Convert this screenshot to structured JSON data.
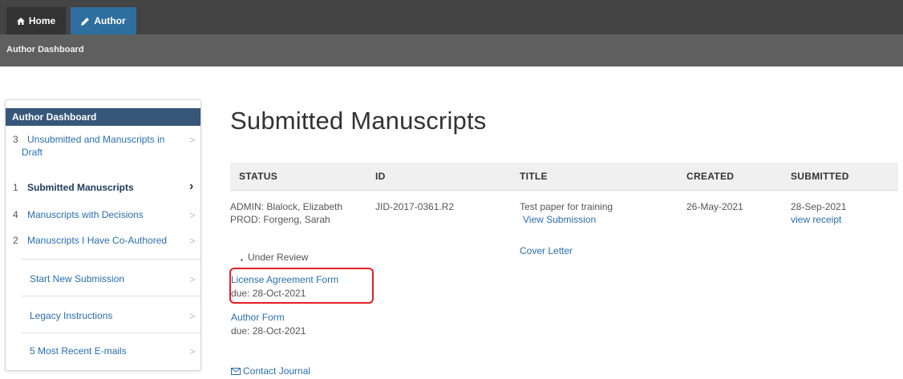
{
  "nav": {
    "home_label": "Home",
    "home_icon": "home-icon",
    "author_label": "Author",
    "author_icon": "pencil-icon",
    "breadcrumb": "Author Dashboard"
  },
  "sidebar": {
    "title": "Author Dashboard",
    "items": [
      {
        "count": "3",
        "label": "Unsubmitted and Manuscripts in",
        "label_line2": "Draft"
      },
      {
        "count": "1",
        "label": "Submitted Manuscripts"
      },
      {
        "count": "4",
        "label": "Manuscripts with Decisions"
      },
      {
        "count": "2",
        "label": "Manuscripts I Have Co-Authored"
      },
      {
        "label": "Start New Submission"
      },
      {
        "label": "Legacy Instructions"
      },
      {
        "label": "5 Most Recent E-mails"
      }
    ],
    "chevron": ">",
    "active_chevron": "›"
  },
  "main": {
    "title": "Submitted Manuscripts",
    "columns": [
      "STATUS",
      "ID",
      "TITLE",
      "CREATED",
      "SUBMITTED"
    ],
    "row": {
      "admin": "ADMIN: Blalock, Elizabeth",
      "prod": "PROD: Forgeng, Sarah",
      "status": "Under Review",
      "license_form": "License Agreement Form",
      "license_due": "due: 28-Oct-2021",
      "author_form": "Author Form",
      "author_due": "due: 28-Oct-2021",
      "contact": "Contact Journal",
      "id": "JID-2017-0361.R2",
      "title": "Test paper for training",
      "view_submission": "View Submission",
      "cover_letter": "Cover Letter",
      "created": "26-May-2021",
      "submitted": "28-Sep-2021",
      "view_receipt": "view receipt"
    }
  },
  "colors": {
    "topbar": "#444444",
    "subbar": "#5f5f5f",
    "author_tab": "#2f6fa0",
    "sidebar_header": "#37577a",
    "link": "#2a6ead",
    "highlight": "#e51f25"
  }
}
